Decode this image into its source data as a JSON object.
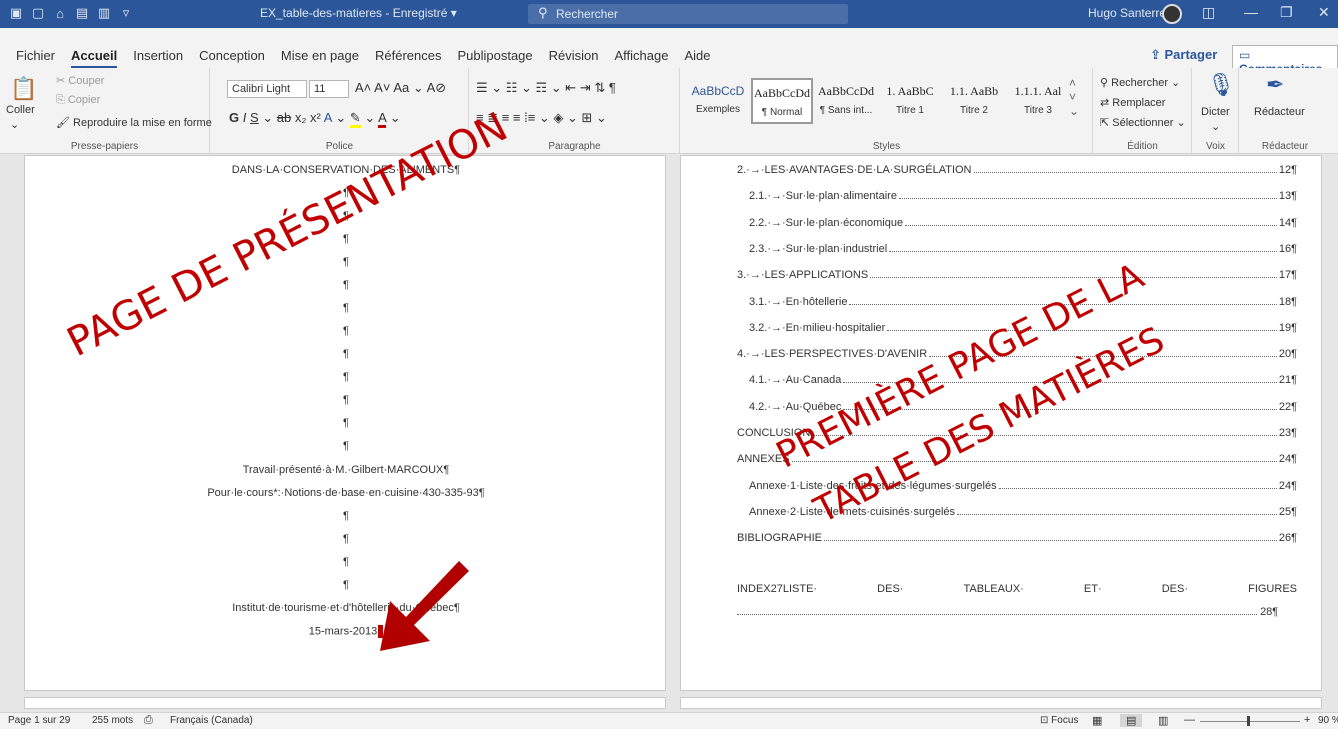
{
  "titlebar": {
    "doc_title": "EX_table-des-matieres - Enregistré ▾",
    "search_placeholder": "Rechercher",
    "user_name": "Hugo Santerre"
  },
  "tabs": [
    "Fichier",
    "Accueil",
    "Insertion",
    "Conception",
    "Mise en page",
    "Références",
    "Publipostage",
    "Révision",
    "Affichage",
    "Aide"
  ],
  "active_tab": "Accueil",
  "share_label": "Partager",
  "comments_label": "Commentaires",
  "ribbon": {
    "clipboard": {
      "paste": "Coller",
      "cut": "Couper",
      "copy": "Copier",
      "format_painter": "Reproduire la mise en forme",
      "label": "Presse-papiers"
    },
    "font": {
      "name": "Calibri Light",
      "size": "11",
      "label": "Police"
    },
    "paragraph": {
      "label": "Paragraphe"
    },
    "styles": {
      "items": [
        {
          "preview": "AaBbCcD",
          "name": "Exemples"
        },
        {
          "preview": "AaBbCcDd",
          "name": "¶ Normal"
        },
        {
          "preview": "AaBbCcDd",
          "name": "¶ Sans int..."
        },
        {
          "preview": "1. AaBbC",
          "name": "Titre 1"
        },
        {
          "preview": "1.1. AaBb",
          "name": "Titre 2"
        },
        {
          "preview": "1.1.1. Aal",
          "name": "Titre 3"
        }
      ],
      "label": "Styles"
    },
    "editing": {
      "find": "Rechercher",
      "replace": "Remplacer",
      "select": "Sélectionner",
      "label": "Édition"
    },
    "voice": {
      "dictate": "Dicter",
      "label": "Voix"
    },
    "editor": {
      "name": "Rédacteur",
      "label": "Rédacteur"
    }
  },
  "left_page": {
    "title_line": "DANS·LA·CONSERVATION·DES·ALIMENTS¶",
    "para_mark": "¶",
    "presented_to": "Travail·présenté·à·M.·Gilbert·MARCOUX¶",
    "course": "Pour·le·cours*:·Notions·de·base·en·cuisine·430-335-93¶",
    "institute": "Institut·de·tourisme·et·d'hôtellerie·du·Québec¶",
    "date": "15-mars-2013"
  },
  "toc": [
    {
      "text": "2.·→·LES·AVANTAGES·DE·LA·SURGÉLATION",
      "page": "12¶",
      "indent": 0
    },
    {
      "text": "2.1.·→·Sur·le·plan·alimentaire",
      "page": "13¶",
      "indent": 1
    },
    {
      "text": "2.2.·→·Sur·le·plan·économique",
      "page": "14¶",
      "indent": 1
    },
    {
      "text": "2.3.·→·Sur·le·plan·industriel",
      "page": "16¶",
      "indent": 1
    },
    {
      "text": "3.·→·LES·APPLICATIONS",
      "page": "17¶",
      "indent": 0
    },
    {
      "text": "3.1.·→·En·hôtellerie",
      "page": "18¶",
      "indent": 1
    },
    {
      "text": "3.2.·→·En·milieu·hospitalier",
      "page": "19¶",
      "indent": 1
    },
    {
      "text": "4.·→·LES·PERSPECTIVES·D'AVENIR",
      "page": "20¶",
      "indent": 0
    },
    {
      "text": "4.1.·→·Au·Canada",
      "page": "21¶",
      "indent": 1
    },
    {
      "text": "4.2.·→·Au·Québec",
      "page": "22¶",
      "indent": 1
    },
    {
      "text": "CONCLUSION",
      "page": "23¶",
      "indent": 0
    },
    {
      "text": "ANNEXES",
      "page": "24¶",
      "indent": 0
    },
    {
      "text": "Annexe·1·Liste·des·fruits·et·des·légumes·surgelés",
      "page": "24¶",
      "indent": 1
    },
    {
      "text": "Annexe·2·Liste·de·mets·cuisinés·surgelés",
      "page": "25¶",
      "indent": 1
    },
    {
      "text": "BIBLIOGRAPHIE",
      "page": "26¶",
      "indent": 0
    }
  ],
  "toc_last_line": {
    "words": [
      "INDEX27LISTE·",
      "DES·",
      "TABLEAUX·",
      "ET·",
      "DES·",
      "FIGURES"
    ],
    "page": "28¶"
  },
  "annotations": {
    "left": "PAGE DE PRÉSENTATION",
    "right_line1": "PREMIÈRE PAGE DE LA",
    "right_line2": "TABLE DES MATIÈRES"
  },
  "statusbar": {
    "page": "Page 1 sur 29",
    "words": "255 mots",
    "lang": "Français (Canada)",
    "focus": "Focus",
    "zoom": "90 %"
  },
  "colors": {
    "word_blue": "#2b579a",
    "annotation_red": "#c00000"
  }
}
